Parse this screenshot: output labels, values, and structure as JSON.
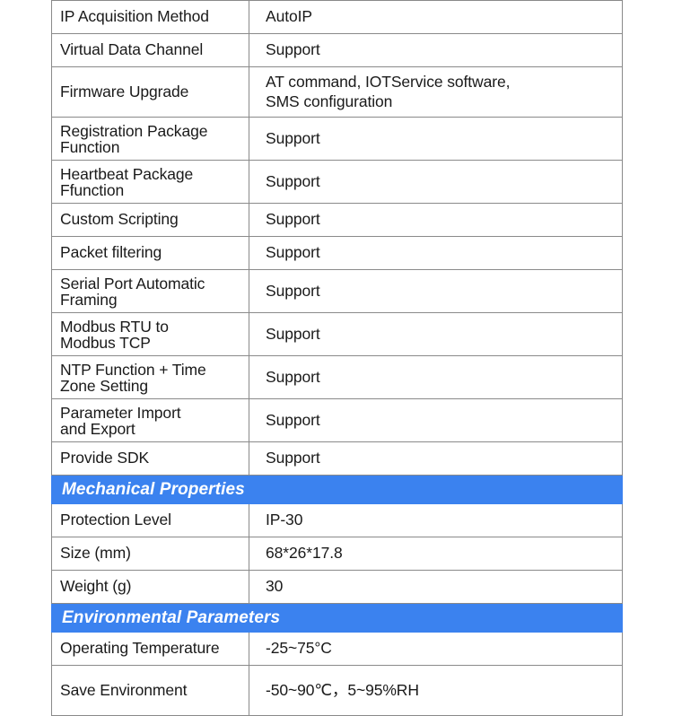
{
  "table": {
    "colors": {
      "section_band": "#3b82ef",
      "section_text": "#ffffff",
      "grid_line": "#8a8a8a",
      "body_text": "#1a1a1a",
      "cell_background": "#ffffff"
    },
    "rows": [
      {
        "kind": "data",
        "label": "IP Acquisition Method",
        "value": "AutoIP"
      },
      {
        "kind": "data",
        "label": "Virtual Data Channel",
        "value": "Support"
      },
      {
        "kind": "data",
        "label": "Firmware Upgrade",
        "value_line1": "AT command, IOTService software,",
        "value_line2": "SMS configuration"
      },
      {
        "kind": "data",
        "label_line1": "Registration Package",
        "label_line2": "Function",
        "value": "Support"
      },
      {
        "kind": "data",
        "label_line1": "Heartbeat Package",
        "label_line2": "Ffunction",
        "value": "Support"
      },
      {
        "kind": "data",
        "label": "Custom Scripting",
        "value": "Support"
      },
      {
        "kind": "data",
        "label": "Packet filtering",
        "value": "Support"
      },
      {
        "kind": "data",
        "label_line1": "Serial Port Automatic",
        "label_line2": "Framing",
        "value": "Support"
      },
      {
        "kind": "data",
        "label_line1": "Modbus RTU to",
        "label_line2": "Modbus TCP",
        "value": "Support"
      },
      {
        "kind": "data",
        "label_line1": "NTP Function + Time",
        "label_line2": "Zone Setting",
        "value": "Support"
      },
      {
        "kind": "data",
        "label_line1": "Parameter Import",
        "label_line2": "and Export",
        "value": "Support"
      },
      {
        "kind": "data",
        "label": "Provide SDK",
        "value": "Support"
      },
      {
        "kind": "section",
        "title": "Mechanical Properties"
      },
      {
        "kind": "data",
        "label": "Protection Level",
        "value": "IP-30"
      },
      {
        "kind": "data",
        "label": "Size (mm)",
        "value": "68*26*17.8"
      },
      {
        "kind": "data",
        "label": "Weight (g)",
        "value": "30"
      },
      {
        "kind": "section",
        "title": "Environmental Parameters"
      },
      {
        "kind": "data",
        "label": "Operating Temperature",
        "value": "-25~75°C"
      },
      {
        "kind": "data",
        "label": "Save Environment",
        "value": "-50~90℃，5~95%RH"
      }
    ]
  }
}
